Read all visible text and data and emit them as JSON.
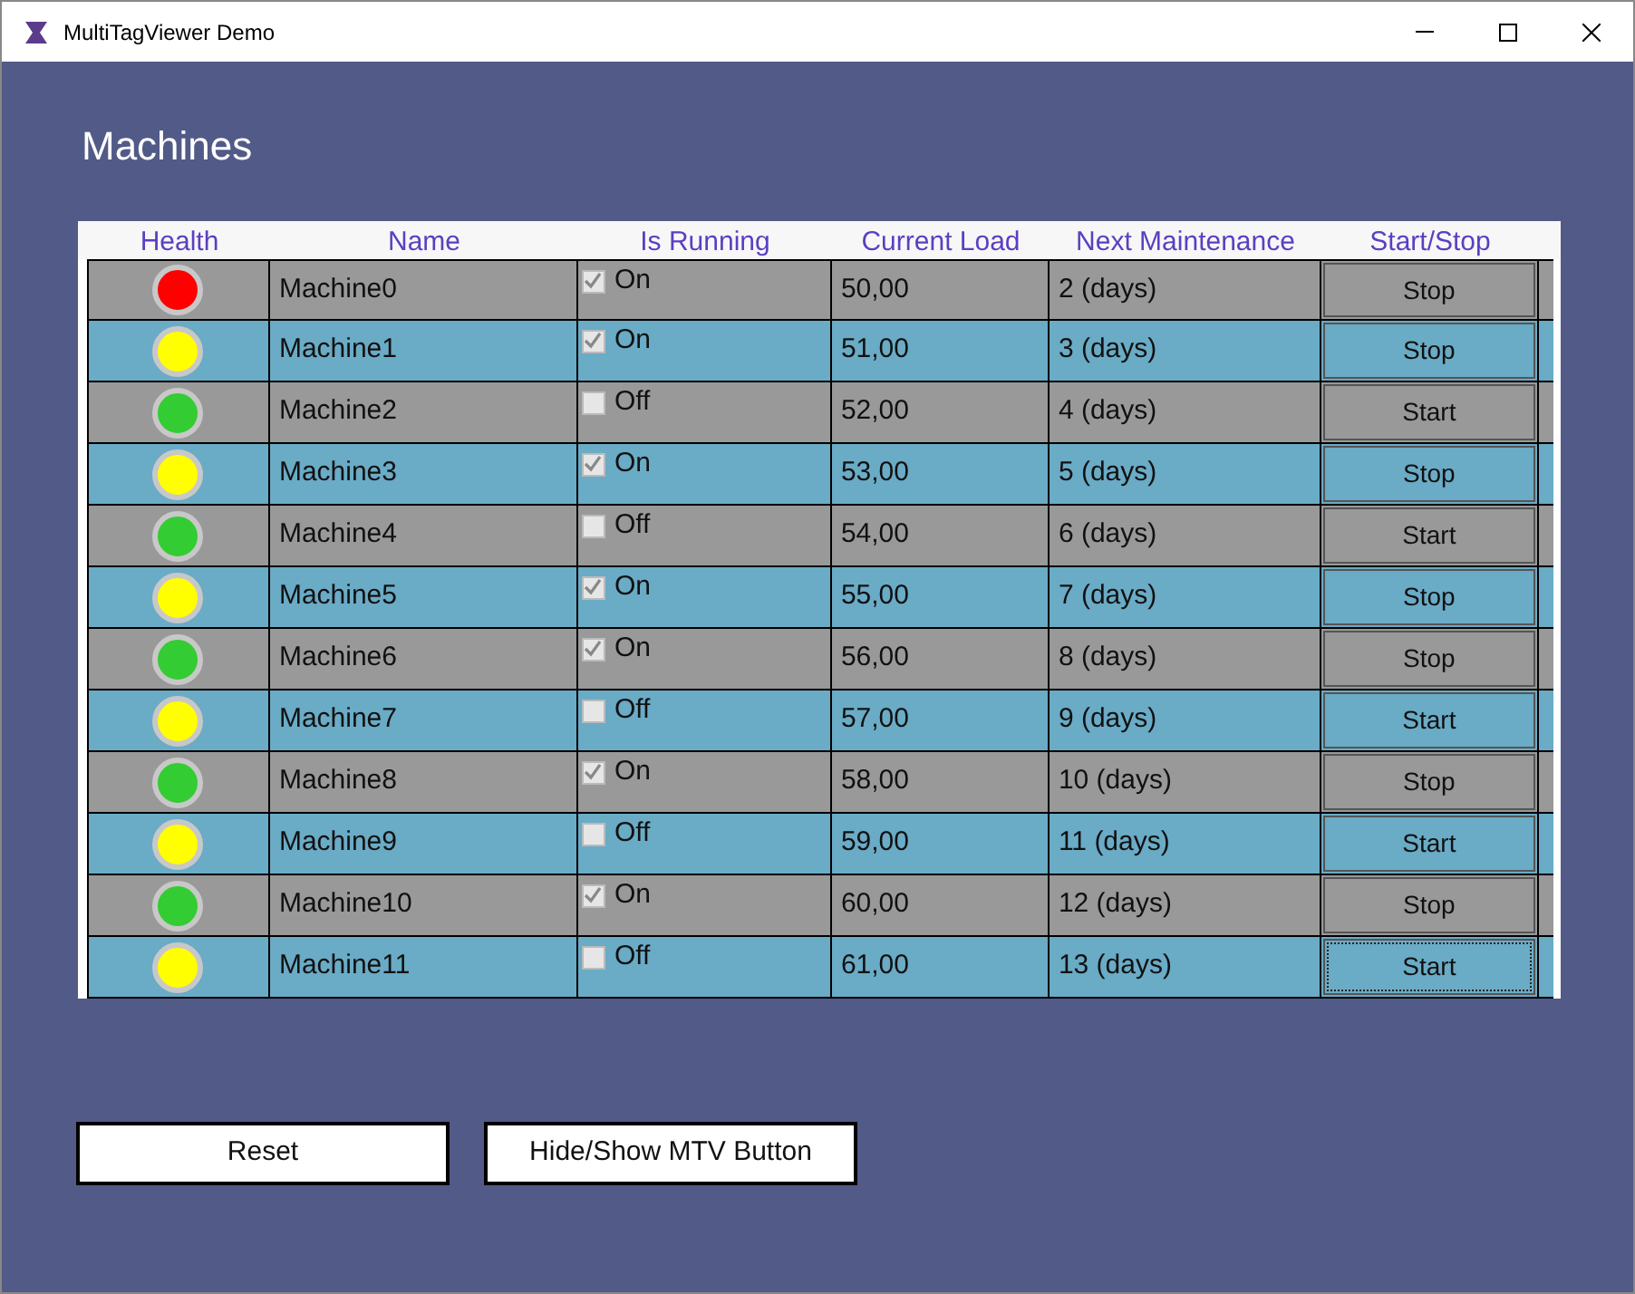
{
  "window": {
    "title": "MultiTagViewer Demo"
  },
  "heading": "Machines",
  "table": {
    "columns": [
      "Health",
      "Name",
      "Is Running",
      "Current Load",
      "Next Maintenance",
      "Start/Stop"
    ],
    "rows": [
      {
        "color": "#ff0000",
        "name": "Machine0",
        "checked": true,
        "running_label": "On",
        "load": "50,00",
        "maintenance": "2 (days)",
        "action": "Stop",
        "focused": false
      },
      {
        "color": "#ffff00",
        "name": "Machine1",
        "checked": true,
        "running_label": "On",
        "load": "51,00",
        "maintenance": "3 (days)",
        "action": "Stop",
        "focused": false
      },
      {
        "color": "#33cc33",
        "name": "Machine2",
        "checked": false,
        "running_label": "Off",
        "load": "52,00",
        "maintenance": "4 (days)",
        "action": "Start",
        "focused": false
      },
      {
        "color": "#ffff00",
        "name": "Machine3",
        "checked": true,
        "running_label": "On",
        "load": "53,00",
        "maintenance": "5 (days)",
        "action": "Stop",
        "focused": false
      },
      {
        "color": "#33cc33",
        "name": "Machine4",
        "checked": false,
        "running_label": "Off",
        "load": "54,00",
        "maintenance": "6 (days)",
        "action": "Start",
        "focused": false
      },
      {
        "color": "#ffff00",
        "name": "Machine5",
        "checked": true,
        "running_label": "On",
        "load": "55,00",
        "maintenance": "7 (days)",
        "action": "Stop",
        "focused": false
      },
      {
        "color": "#33cc33",
        "name": "Machine6",
        "checked": true,
        "running_label": "On",
        "load": "56,00",
        "maintenance": "8 (days)",
        "action": "Stop",
        "focused": false
      },
      {
        "color": "#ffff00",
        "name": "Machine7",
        "checked": false,
        "running_label": "Off",
        "load": "57,00",
        "maintenance": "9 (days)",
        "action": "Start",
        "focused": false
      },
      {
        "color": "#33cc33",
        "name": "Machine8",
        "checked": true,
        "running_label": "On",
        "load": "58,00",
        "maintenance": "10 (days)",
        "action": "Stop",
        "focused": false
      },
      {
        "color": "#ffff00",
        "name": "Machine9",
        "checked": false,
        "running_label": "Off",
        "load": "59,00",
        "maintenance": "11 (days)",
        "action": "Start",
        "focused": false
      },
      {
        "color": "#33cc33",
        "name": "Machine10",
        "checked": true,
        "running_label": "On",
        "load": "60,00",
        "maintenance": "12 (days)",
        "action": "Stop",
        "focused": false
      },
      {
        "color": "#ffff00",
        "name": "Machine11",
        "checked": false,
        "running_label": "Off",
        "load": "61,00",
        "maintenance": "13 (days)",
        "action": "Start",
        "focused": true
      }
    ]
  },
  "buttons": [
    "Reset",
    "Hide/Show MTV Button"
  ]
}
